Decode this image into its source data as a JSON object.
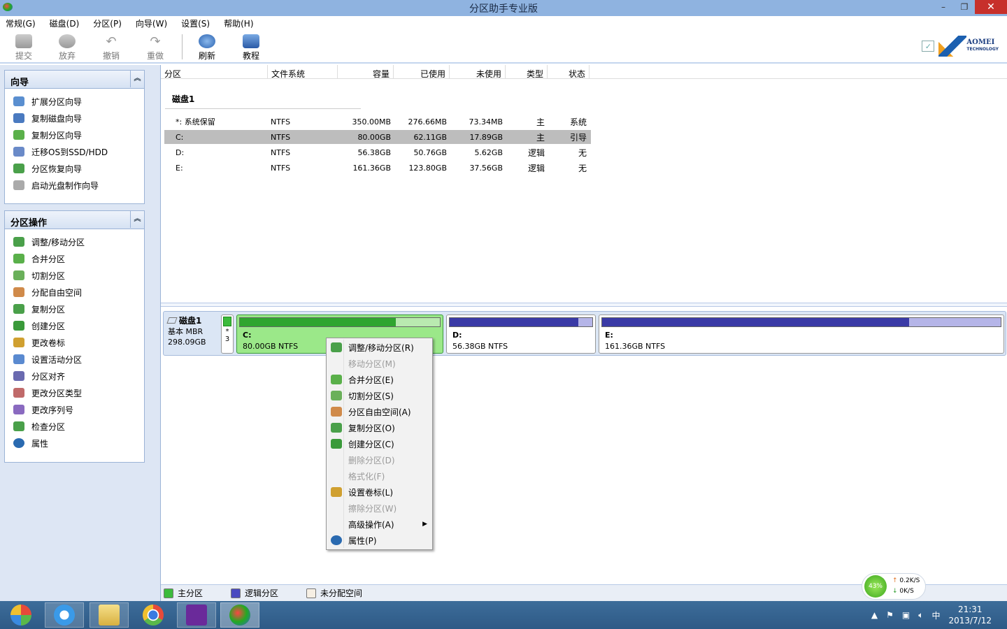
{
  "window": {
    "title": "分区助手专业版",
    "minimize": "–",
    "restore": "❐",
    "close": "✕"
  },
  "menu": [
    "常规(G)",
    "磁盘(D)",
    "分区(P)",
    "向导(W)",
    "设置(S)",
    "帮助(H)"
  ],
  "toolbar": {
    "submit": "提交",
    "discard": "放弃",
    "undo": "撤销",
    "redo": "重做",
    "refresh": "刷新",
    "tutorial": "教程",
    "brand": "AOMEI",
    "brand_sub": "TECHNOLOGY"
  },
  "wizard_panel": {
    "title": "向导",
    "items": [
      "扩展分区向导",
      "复制磁盘向导",
      "复制分区向导",
      "迁移OS到SSD/HDD",
      "分区恢复向导",
      "启动光盘制作向导"
    ]
  },
  "ops_panel": {
    "title": "分区操作",
    "items": [
      "调整/移动分区",
      "合并分区",
      "切割分区",
      "分配自由空间",
      "复制分区",
      "创建分区",
      "更改卷标",
      "设置活动分区",
      "分区对齐",
      "更改分区类型",
      "更改序列号",
      "检查分区",
      "属性"
    ]
  },
  "table": {
    "columns": [
      "分区",
      "文件系统",
      "容量",
      "已使用",
      "未使用",
      "类型",
      "状态"
    ],
    "disk_label": "磁盘1",
    "rows": [
      {
        "name": "*: 系统保留",
        "fs": "NTFS",
        "cap": "350.00MB",
        "used": "276.66MB",
        "free": "73.34MB",
        "type": "主",
        "status": "系统"
      },
      {
        "name": "C:",
        "fs": "NTFS",
        "cap": "80.00GB",
        "used": "62.11GB",
        "free": "17.89GB",
        "type": "主",
        "status": "引导"
      },
      {
        "name": "D:",
        "fs": "NTFS",
        "cap": "56.38GB",
        "used": "50.76GB",
        "free": "5.62GB",
        "type": "逻辑",
        "status": "无"
      },
      {
        "name": "E:",
        "fs": "NTFS",
        "cap": "161.36GB",
        "used": "123.80GB",
        "free": "37.56GB",
        "type": "逻辑",
        "status": "无"
      }
    ]
  },
  "diskmap": {
    "name": "磁盘1",
    "kind": "基本 MBR",
    "size": "298.09GB",
    "sysres_top": "*",
    "sysres_bottom": "3",
    "c": {
      "label": "C:",
      "desc": "80.00GB NTFS",
      "used_fraction": 0.78
    },
    "d": {
      "label": "D:",
      "desc": "56.38GB NTFS",
      "used_fraction": 0.9
    },
    "e": {
      "label": "E:",
      "desc": "161.36GB NTFS",
      "used_fraction": 0.77
    }
  },
  "legend": [
    "主分区",
    "逻辑分区",
    "未分配空间"
  ],
  "context_menu": [
    {
      "label": "调整/移动分区(R)",
      "enabled": true
    },
    {
      "label": "移动分区(M)",
      "enabled": false
    },
    {
      "label": "合并分区(E)",
      "enabled": true
    },
    {
      "label": "切割分区(S)",
      "enabled": true
    },
    {
      "label": "分区自由空间(A)",
      "enabled": true
    },
    {
      "label": "复制分区(O)",
      "enabled": true
    },
    {
      "label": "创建分区(C)",
      "enabled": true
    },
    {
      "label": "删除分区(D)",
      "enabled": false
    },
    {
      "label": "格式化(F)",
      "enabled": false
    },
    {
      "label": "设置卷标(L)",
      "enabled": true
    },
    {
      "label": "擦除分区(W)",
      "enabled": false
    },
    {
      "label": "高级操作(A)",
      "enabled": true
    },
    {
      "label": "属性(P)",
      "enabled": true
    }
  ],
  "net_widget": {
    "percent": "43%",
    "up": "0.2K/S",
    "down": "0K/S"
  },
  "tray": {
    "ime": "中",
    "time": "21:31",
    "date": "2013/7/12"
  },
  "colors": {
    "primary": "#2fa52f",
    "logical": "#3a3aa6",
    "accent": "#1c60b0"
  }
}
